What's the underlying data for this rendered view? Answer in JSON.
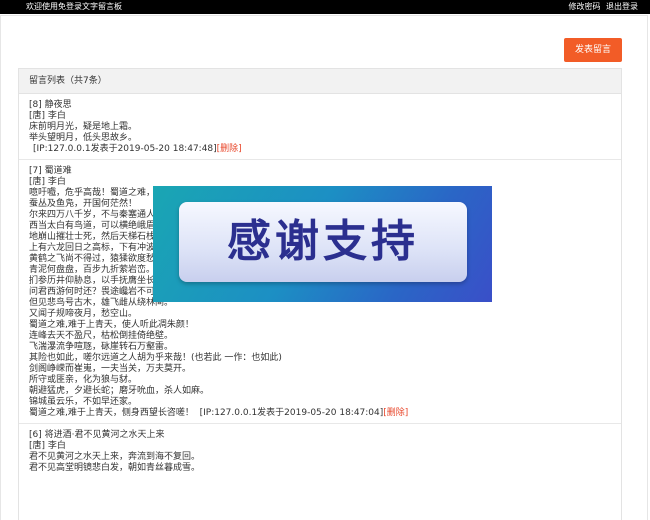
{
  "topbar": {
    "welcome": "欢迎使用免登录文字留言板",
    "change_password": "修改密码",
    "logout": "退出登录"
  },
  "post_button": "发表留言",
  "list": {
    "header": "留言列表（共7条）",
    "messages": [
      {
        "title": "[8] 静夜思",
        "author": "[唐] 李白",
        "lines": [
          "床前明月光，疑是地上霜。",
          "举头望明月，低头思故乡。"
        ],
        "meta": "[IP:127.0.0.1发表于2019-05-20 18:47:48]",
        "delete": "[删除]"
      },
      {
        "title": "[7] 蜀道难",
        "author": "[唐] 李白",
        "lines": [
          "噫吁嚱，危乎高哉！蜀道之难，难",
          "蚕丛及鱼凫，开国何茫然！",
          "尔来四万八千岁，不与秦塞通人烟",
          "西当太白有鸟道，可以横绝峨眉巅",
          "地崩山摧壮士死，然后天梯石栈相",
          "上有六龙回日之高标，下有冲波逆",
          "黄鹤之飞尚不得过，猿猱欲度愁攀",
          "青泥何盘盘，百步九折萦岩峦。",
          "扪参历井仰胁息，以手抚膺坐长叹。",
          "问君西游何时还？畏途巉岩不可攀。",
          "但见悲鸟号古木，雄飞雌从绕林间。",
          "又闻子规啼夜月，愁空山。",
          "蜀道之难,难于上青天，使人听此凋朱颜！",
          "连峰去天不盈尺，枯松倒挂倚绝壁。",
          "飞湍瀑流争喧豗，砯崖转石万壑雷。",
          "其险也如此，嗟尔远道之人胡为乎来哉！(也若此 一作：也如此)",
          "剑阁峥嵘而崔嵬，一夫当关，万夫莫开。",
          "所守或匪亲，化为狼与豺。",
          "朝避猛虎，夕避长蛇；磨牙吮血，杀人如麻。",
          "锦城虽云乐，不如早还家。"
        ],
        "last_line": "蜀道之难,难于上青天，侧身西望长咨嗟！",
        "meta": "[IP:127.0.0.1发表于2019-05-20 18:47:04]",
        "delete": "[删除]"
      },
      {
        "title": "[6] 将进酒·君不见黄河之水天上来",
        "author": "[唐] 李白",
        "lines": [
          "君不见黄河之水天上来，奔流到海不复回。",
          "君不见高堂明镜悲白发，朝如青丝暮成雪。"
        ]
      }
    ]
  },
  "overlay_text": "感谢支持"
}
